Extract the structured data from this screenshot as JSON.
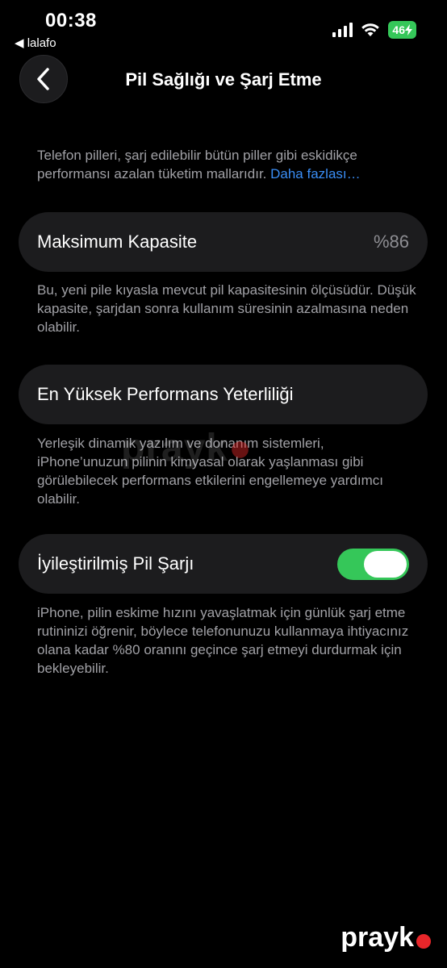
{
  "status_bar": {
    "time": "00:38",
    "back_app": "◀ lalafo",
    "battery": "46"
  },
  "nav": {
    "title": "Pil Sağlığı ve Şarj Etme"
  },
  "intro": {
    "text": "Telefon pilleri, şarj edilebilir bütün piller gibi eskidikçe performansı azalan tüketim mallarıdır. ",
    "link": "Daha fazlası…"
  },
  "max_capacity": {
    "label": "Maksimum Kapasite",
    "value": "%86",
    "description": "Bu, yeni pile kıyasla mevcut pil kapasitesinin ölçüsüdür. Düşük kapasite, şarjdan sonra kullanım süresinin azalmasına neden olabilir."
  },
  "peak_performance": {
    "label": "En Yüksek Performans Yeterliliği",
    "description": "Yerleşik dinamik yazılım ve donanım sistemleri, iPhone’unuzun pilinin kimyasal olarak yaşlanması gibi görülebilecek performans etkilerini engellemeye yardımcı olabilir."
  },
  "optimized_charging": {
    "label": "İyileştirilmiş Pil Şarjı",
    "enabled": true,
    "description": "iPhone, pilin eskime hızını yavaşlatmak için günlük şarj etme rutininizi öğrenir, böylece telefonunuzu kullanmaya ihtiyacınız olana kadar %80 oranını geçince şarj etmeyi durdurmak için bekleyebilir."
  },
  "watermark": {
    "text": "prayk",
    "corner_text": "prayk"
  },
  "colors": {
    "background": "#000000",
    "card": "#1c1c1e",
    "accent_green": "#35c759",
    "link_blue": "#3a8ef6",
    "secondary_text": "#a1a1a6"
  },
  "icons": [
    "chevron-left-icon",
    "signal-icon",
    "wifi-icon",
    "battery-charging-icon"
  ]
}
